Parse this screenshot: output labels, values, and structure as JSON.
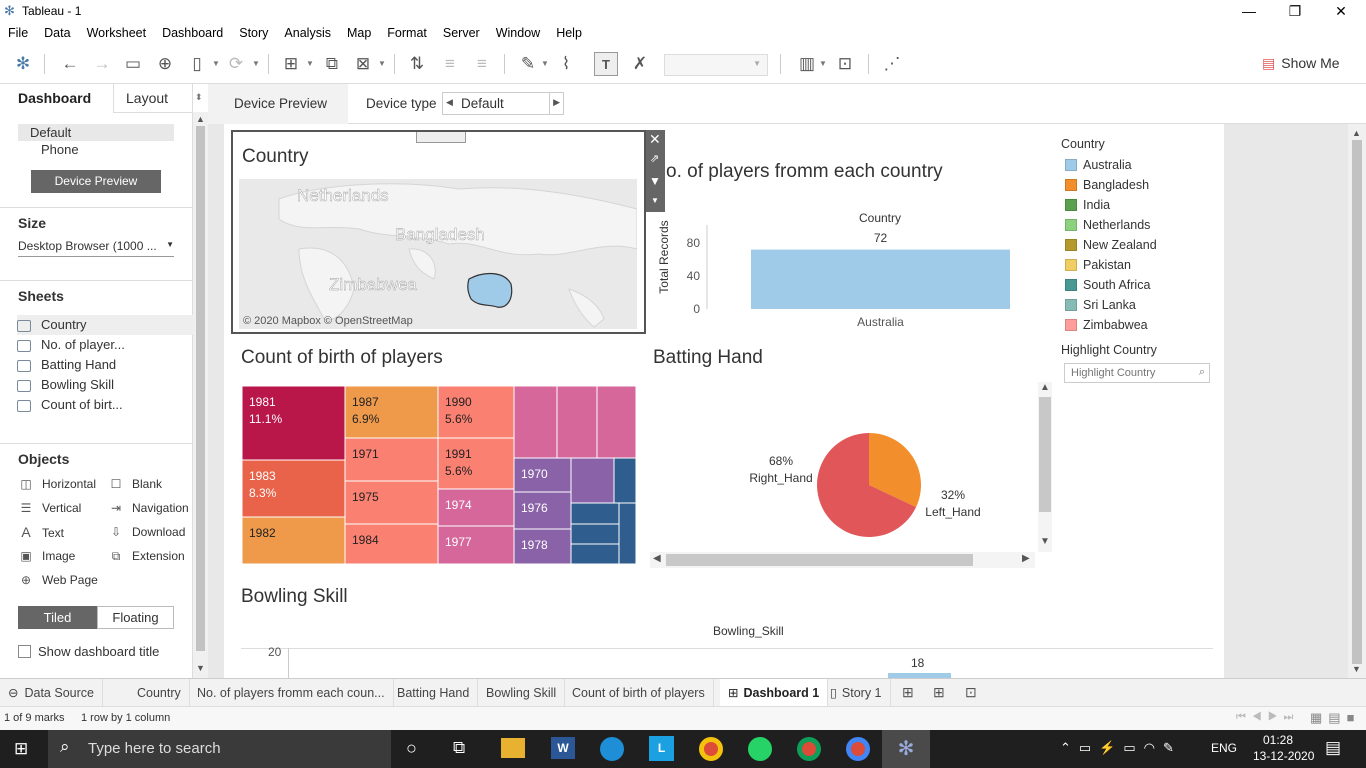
{
  "window": {
    "title": "Tableau - 1"
  },
  "menu": [
    "File",
    "Data",
    "Worksheet",
    "Dashboard",
    "Story",
    "Analysis",
    "Map",
    "Format",
    "Server",
    "Window",
    "Help"
  ],
  "toolbar": {
    "show_me": "Show Me"
  },
  "left": {
    "tab_dashboard": "Dashboard",
    "tab_layout": "Layout",
    "device_default": "Default",
    "device_phone": "Phone",
    "device_preview_btn": "Device Preview",
    "size_title": "Size",
    "size_value": "Desktop Browser (1000 ...",
    "sheets_title": "Sheets",
    "sheets": [
      "Country",
      "No. of player...",
      "Batting Hand",
      "Bowling Skill",
      "Count of birt..."
    ],
    "objects_title": "Objects",
    "objects": [
      {
        "label": "Horizontal",
        "icon": "horizontal-icon"
      },
      {
        "label": "Blank",
        "icon": "blank-icon"
      },
      {
        "label": "Vertical",
        "icon": "vertical-icon"
      },
      {
        "label": "Navigation",
        "icon": "navigation-icon"
      },
      {
        "label": "Text",
        "icon": "text-icon"
      },
      {
        "label": "Download",
        "icon": "download-icon"
      },
      {
        "label": "Image",
        "icon": "image-icon"
      },
      {
        "label": "Extension",
        "icon": "extension-icon"
      },
      {
        "label": "Web Page",
        "icon": "web-page-icon"
      }
    ],
    "tiled": "Tiled",
    "floating": "Floating",
    "show_title": "Show dashboard title"
  },
  "devbar": {
    "device_preview": "Device Preview",
    "device_type_label": "Device type",
    "device_type_value": "Default"
  },
  "dashboard": {
    "map_title": "Country",
    "map_labels": [
      "Netherlands",
      "Bangladesh",
      "Zimbabwea"
    ],
    "map_credit": "© 2020 Mapbox © OpenStreetMap",
    "bar_title": "o. of players fromm each country",
    "treemap_title": "Count of birth of players",
    "pie_title": "Batting Hand",
    "bowling_title": "Bowling Skill",
    "bowling_axis_title": "Bowling_Skill",
    "bowling_tick": "20",
    "bowling_value": "18",
    "legend_title": "Country",
    "legend": [
      {
        "name": "Australia",
        "color": "#a0cbe8"
      },
      {
        "name": "Bangladesh",
        "color": "#f28e2b"
      },
      {
        "name": "India",
        "color": "#59a14f"
      },
      {
        "name": "Netherlands",
        "color": "#8cd17d"
      },
      {
        "name": "New Zealand",
        "color": "#b6992d"
      },
      {
        "name": "Pakistan",
        "color": "#f1ce63"
      },
      {
        "name": "South Africa",
        "color": "#499894"
      },
      {
        "name": "Sri Lanka",
        "color": "#86bcb6"
      },
      {
        "name": "Zimbabwea",
        "color": "#ff9d9a"
      }
    ],
    "highlight_title": "Highlight Country",
    "highlight_placeholder": "Highlight Country"
  },
  "chart_data": [
    {
      "type": "bar",
      "title": "o. of players fromm each country",
      "header": "Country",
      "categories": [
        "Australia"
      ],
      "values": [
        72
      ],
      "ylabel": "Total Records",
      "yticks": [
        "80",
        "40",
        "0"
      ],
      "ylim": [
        0,
        80
      ]
    },
    {
      "type": "pie",
      "title": "Batting Hand",
      "slices": [
        {
          "label": "Right_Hand",
          "pct_label": "68%",
          "value": 68,
          "color": "#e15759"
        },
        {
          "label": "Left_Hand",
          "pct_label": "32%",
          "value": 32,
          "color": "#f28e2b"
        }
      ]
    },
    {
      "type": "treemap",
      "title": "Count of birth of players",
      "cells": [
        {
          "year": "1981",
          "pct": "11.1%",
          "color": "#b9164a"
        },
        {
          "year": "1983",
          "pct": "8.3%",
          "color": "#e8634a"
        },
        {
          "year": "1982",
          "pct": "",
          "color": "#ee9a4a"
        },
        {
          "year": "1987",
          "pct": "6.9%",
          "color": "#ee9a4a"
        },
        {
          "year": "1971",
          "pct": "",
          "color": "#fa8072"
        },
        {
          "year": "1975",
          "pct": "",
          "color": "#fa8072"
        },
        {
          "year": "1984",
          "pct": "",
          "color": "#fa8072"
        },
        {
          "year": "1990",
          "pct": "5.6%",
          "color": "#fa8072"
        },
        {
          "year": "1991",
          "pct": "5.6%",
          "color": "#fa8072"
        },
        {
          "year": "1974",
          "pct": "",
          "color": "#d5679b"
        },
        {
          "year": "1977",
          "pct": "",
          "color": "#d5679b"
        },
        {
          "year": "1970",
          "pct": "",
          "color": "#8a62a8"
        },
        {
          "year": "1976",
          "pct": "",
          "color": "#8a62a8"
        },
        {
          "year": "1978",
          "pct": "",
          "color": "#8a62a8"
        }
      ]
    }
  ],
  "tabs": [
    "Data Source",
    "Country",
    "No. of players fromm each coun...",
    "Batting Hand",
    "Bowling Skill",
    "Count of birth of players",
    "Dashboard 1",
    "Story 1"
  ],
  "status": {
    "marks": "1 of 9 marks",
    "rows": "1 row by 1 column"
  },
  "taskbar": {
    "search_placeholder": "Type here to search",
    "lang": "ENG",
    "time": "01:28",
    "date": "13-12-2020"
  }
}
